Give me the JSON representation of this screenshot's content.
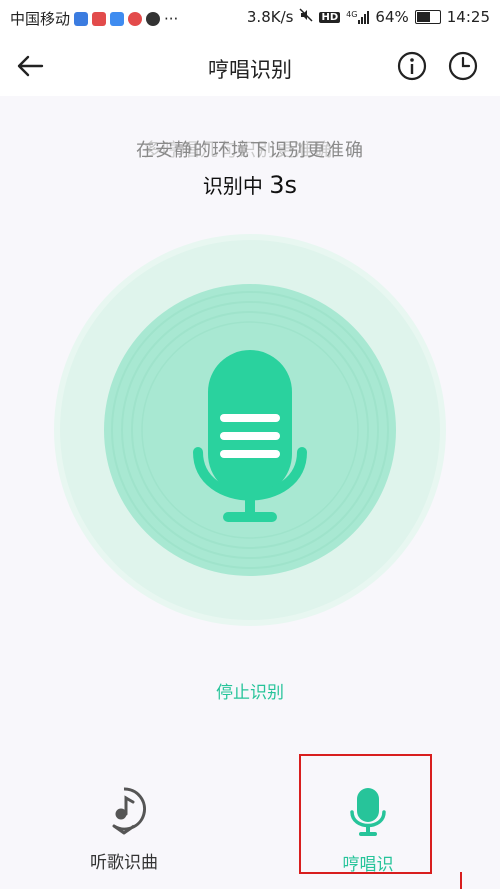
{
  "status_bar": {
    "carrier": "中国移动",
    "speed": "3.8K/s",
    "network": "4G",
    "hd": "HD",
    "battery": "64%",
    "battery_level": 0.64,
    "time": "14:25",
    "more": "···"
  },
  "header": {
    "title": "哼唱识别"
  },
  "main": {
    "tip": "在安静的环境下识别更准确",
    "tip_ghost": "多哼唱几句识别更准确",
    "status_prefix": "识别中",
    "seconds": "3s",
    "stop_label": "停止识别"
  },
  "tabs": [
    {
      "label": "听歌识曲",
      "icon": "music-note-icon"
    },
    {
      "label": "哼唱识",
      "icon": "microphone-icon"
    }
  ],
  "colors": {
    "accent": "#27c49a",
    "mic": "#2ad29e",
    "highlight": "#d81e1e"
  }
}
